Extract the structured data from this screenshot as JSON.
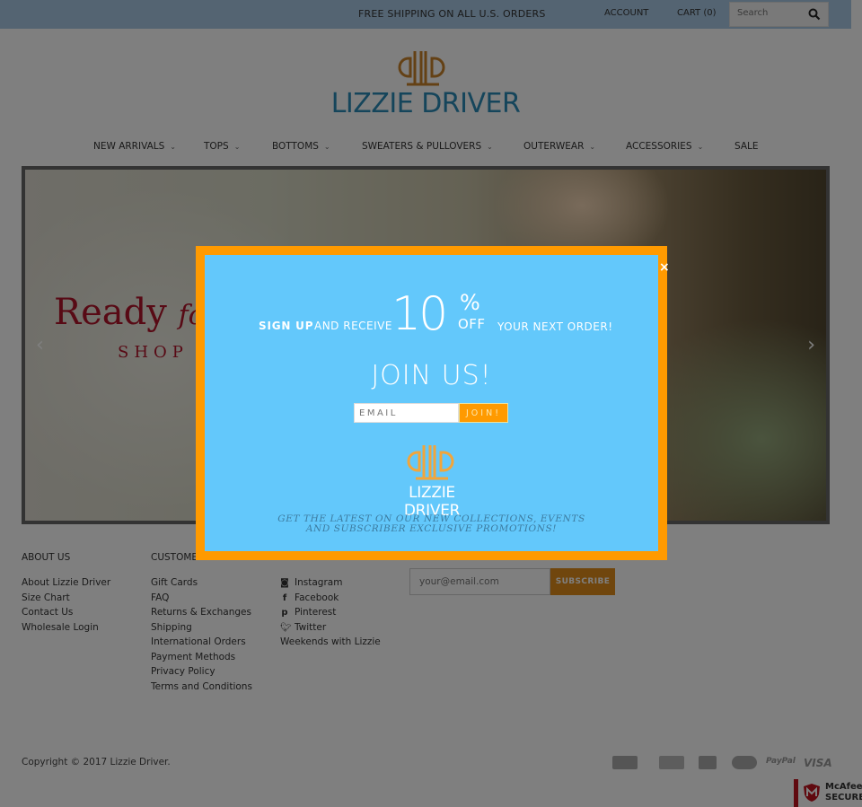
{
  "topbar": {
    "promo": "FREE SHIPPING ON ALL U.S. ORDERS",
    "account_label": "ACCOUNT",
    "cart_label": "CART (0)",
    "search_placeholder": "Search",
    "search_icon": "search-icon"
  },
  "brand": {
    "name": "LIZZIE DRIVER",
    "logo_color": "#c9822a",
    "text_color": "#2a8bb7"
  },
  "nav": {
    "items": [
      {
        "label": "NEW ARRIVALS",
        "has_dropdown": true
      },
      {
        "label": "TOPS",
        "has_dropdown": true
      },
      {
        "label": "BOTTOMS",
        "has_dropdown": true
      },
      {
        "label": "SWEATERS & PULLOVERS",
        "has_dropdown": true
      },
      {
        "label": "OUTERWEAR",
        "has_dropdown": true
      },
      {
        "label": "ACCESSORIES",
        "has_dropdown": true
      },
      {
        "label": "SALE",
        "has_dropdown": false
      }
    ]
  },
  "hero": {
    "headline": "Ready",
    "headline_italic": "fo",
    "subline": "SHOP",
    "prev_icon": "chevron-left-icon",
    "next_icon": "chevron-right-icon"
  },
  "footer": {
    "about": {
      "title": "ABOUT US",
      "links": [
        "About Lizzie Driver",
        "Size Chart",
        "Contact Us",
        "Wholesale Login"
      ]
    },
    "customer": {
      "title": "CUSTOME",
      "links": [
        "Gift Cards",
        "FAQ",
        "Returns & Exchanges",
        "Shipping",
        "International Orders",
        "Payment Methods",
        "Privacy Policy",
        "Terms and Conditions"
      ]
    },
    "social": {
      "links": [
        {
          "label": "Instagram",
          "icon": "instagram-icon"
        },
        {
          "label": "Facebook",
          "icon": "facebook-icon"
        },
        {
          "label": "Pinterest",
          "icon": "pinterest-icon"
        },
        {
          "label": "Twitter",
          "icon": "twitter-icon"
        },
        {
          "label": "Weekends with Lizzie",
          "icon": ""
        }
      ]
    },
    "newsletter": {
      "placeholder": "your@email.com",
      "button": "SUBSCRIBE"
    },
    "copyright": "Copyright © 2017 Lizzie Driver.",
    "payments": [
      "amex",
      "discover",
      "jcb",
      "mastercard",
      "PayPal",
      "VISA"
    ],
    "mcafee": {
      "line1": "McAfee",
      "line2": "SECURE"
    }
  },
  "modal": {
    "close_label": "×",
    "sign_up": "SIGN UP",
    "and_receive": "AND RECEIVE",
    "discount": "10",
    "percent": "%",
    "off": "OFF",
    "next_order": "YOUR NEXT ORDER!",
    "join_us": "JOIN US!",
    "email_placeholder": "EMAIL",
    "join_button": "JOIN!",
    "brand": "LIZZIE DRIVER",
    "tagline_1": "Get the latest on our new collections, events",
    "tagline_2": "and subscriber exclusive promotions!",
    "border_color": "#ff9a00",
    "bg_color": "#63c8fb"
  }
}
